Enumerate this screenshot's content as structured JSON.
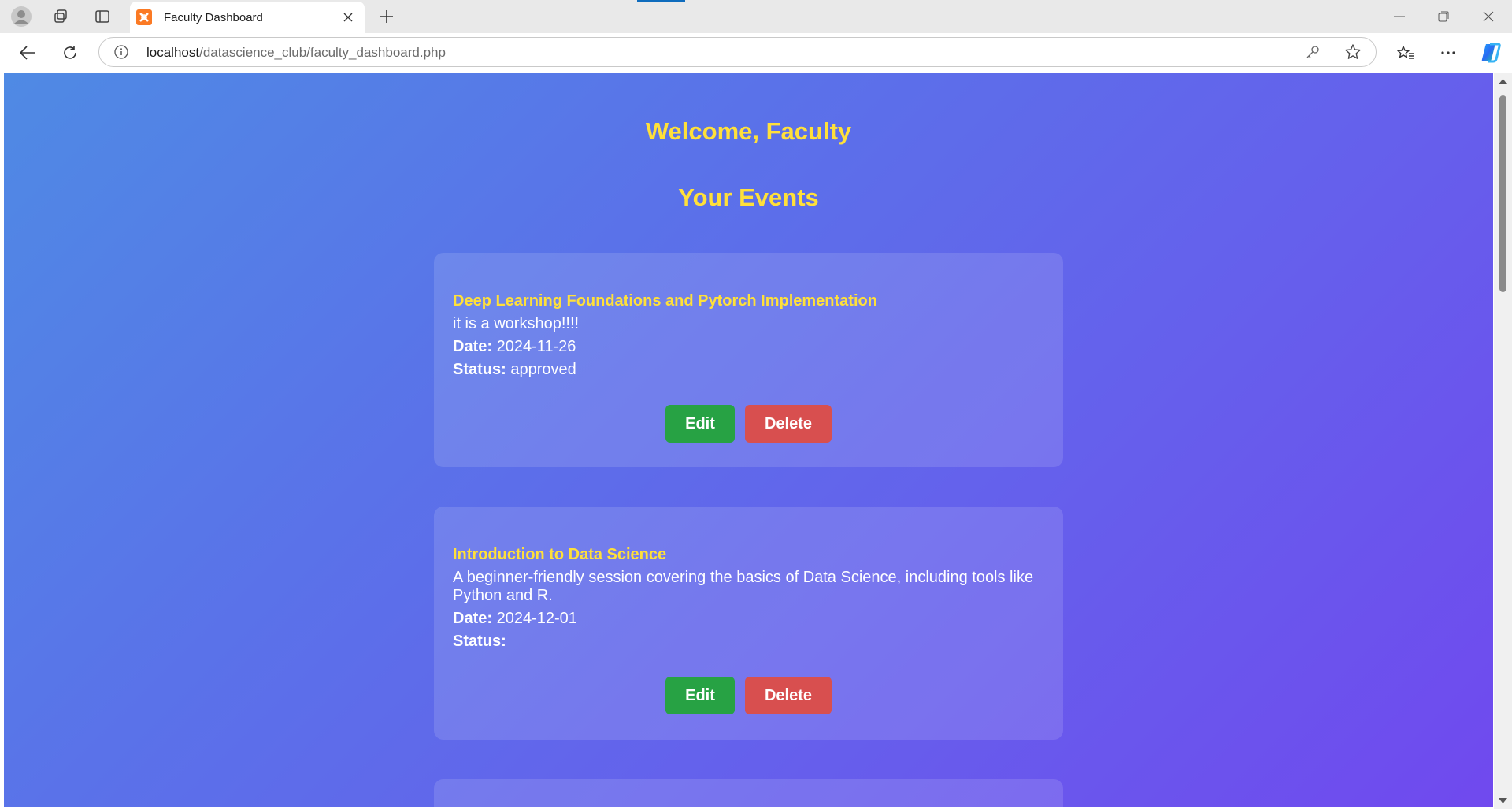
{
  "browser": {
    "tab_title": "Faculty Dashboard",
    "url_host": "localhost",
    "url_path": "/datascience_club/faculty_dashboard.php"
  },
  "page": {
    "welcome": "Welcome, Faculty",
    "section_title": "Your Events",
    "events": [
      {
        "title": "Deep Learning Foundations and Pytorch Implementation",
        "description": "it is a workshop!!!!",
        "date_label": "Date:",
        "date": "2024-11-26",
        "status_label": "Status:",
        "status": "approved",
        "edit_label": "Edit",
        "delete_label": "Delete"
      },
      {
        "title": "Introduction to Data Science",
        "description": "A beginner-friendly session covering the basics of Data Science, including tools like Python and R.",
        "date_label": "Date:",
        "date": "2024-12-01",
        "status_label": "Status:",
        "status": "",
        "edit_label": "Edit",
        "delete_label": "Delete"
      }
    ]
  },
  "colors": {
    "heading": "#ffe03a",
    "edit_button": "#27a244",
    "delete_button": "#d84f4f",
    "gradient_start": "#4f8ae4",
    "gradient_end": "#7049ee"
  }
}
